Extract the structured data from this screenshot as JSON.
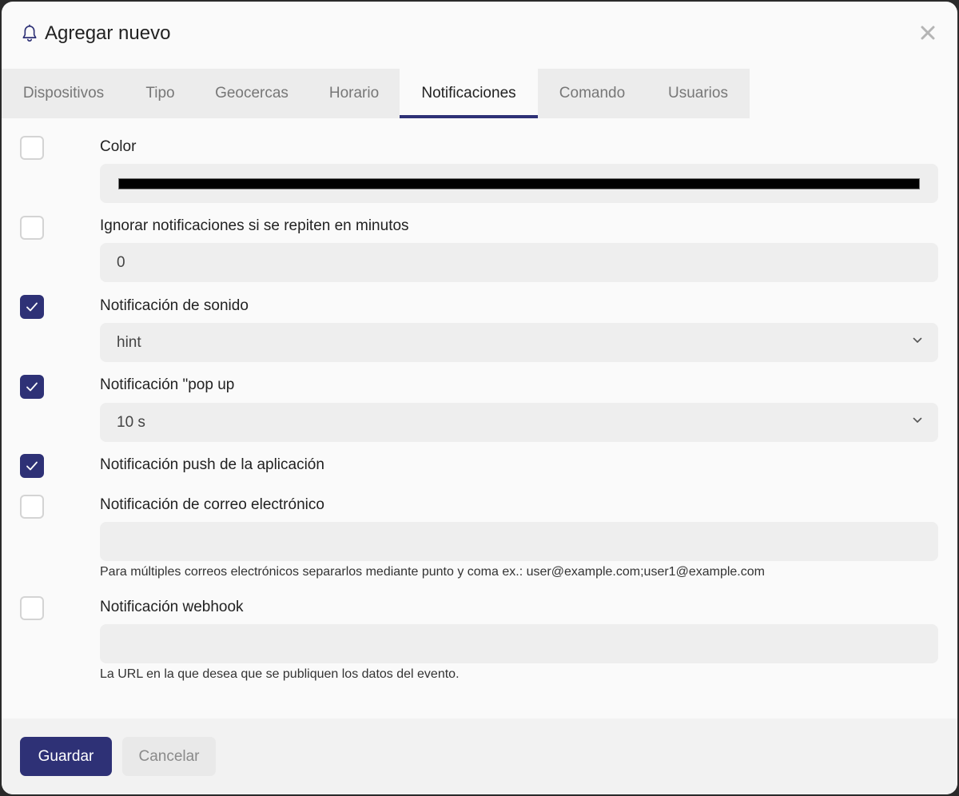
{
  "dialog": {
    "title": "Agregar nuevo",
    "icon": "bell-icon",
    "accent_color": "#2e3176"
  },
  "tabs": [
    {
      "label": "Dispositivos",
      "active": false
    },
    {
      "label": "Tipo",
      "active": false
    },
    {
      "label": "Geocercas",
      "active": false
    },
    {
      "label": "Horario",
      "active": false
    },
    {
      "label": "Notificaciones",
      "active": true
    },
    {
      "label": "Comando",
      "active": false
    },
    {
      "label": "Usuarios",
      "active": false
    }
  ],
  "rows": {
    "color": {
      "label": "Color",
      "checked": false,
      "value": "#000000"
    },
    "ignore": {
      "label": "Ignorar notificaciones si se repiten en minutos",
      "checked": false,
      "value": "0"
    },
    "sound": {
      "label": "Notificación de sonido",
      "checked": true,
      "value": "hint"
    },
    "popup": {
      "label": "Notificación \"pop up",
      "checked": true,
      "value": "10 s"
    },
    "push": {
      "label": "Notificación push de la aplicación",
      "checked": true
    },
    "email": {
      "label": "Notificación de correo electrónico",
      "checked": false,
      "value": "",
      "hint": "Para múltiples correos electrónicos separarlos mediante punto y coma ex.: user@example.com;user1@example.com"
    },
    "webhook": {
      "label": "Notificación webhook",
      "checked": false,
      "value": "",
      "hint": "La URL en la que desea que se publiquen los datos del evento."
    }
  },
  "footer": {
    "save_label": "Guardar",
    "cancel_label": "Cancelar"
  }
}
